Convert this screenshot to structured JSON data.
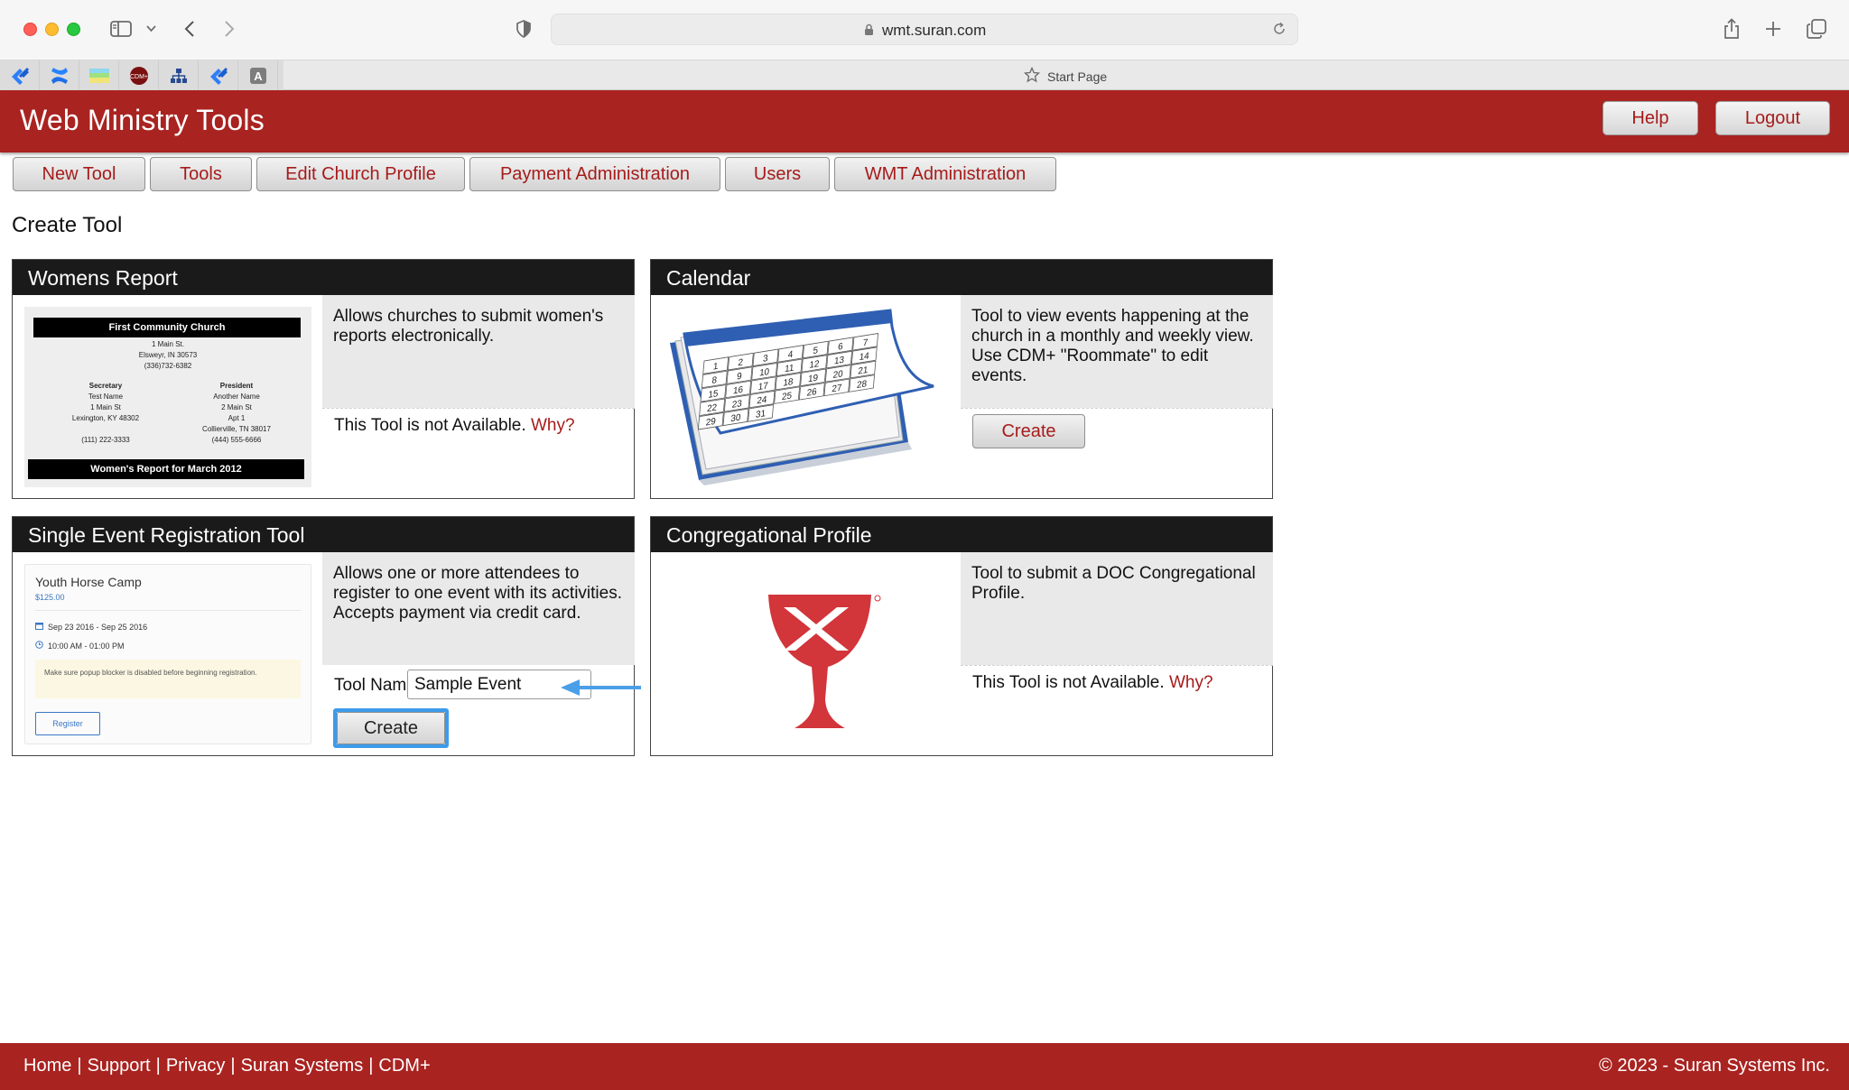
{
  "browser": {
    "url": "wmt.suran.com",
    "start_page_label": "Start Page",
    "favorites_icons": [
      "jira-icon",
      "confluence-icon",
      "spreadsheet-icon",
      "cdm-icon",
      "sitemap-icon",
      "jira-icon",
      "font-app-icon"
    ]
  },
  "app": {
    "title": "Web Ministry Tools",
    "help_label": "Help",
    "logout_label": "Logout",
    "header_color": "#a92320"
  },
  "nav": {
    "items": [
      "New Tool",
      "Tools",
      "Edit Church Profile",
      "Payment Administration",
      "Users",
      "WMT Administration"
    ]
  },
  "page": {
    "title": "Create Tool"
  },
  "cards": {
    "womens": {
      "title": "Womens Report",
      "description": "Allows churches to submit women's reports electronically.",
      "unavailable": "This Tool is not Available.",
      "why": "Why?",
      "thumb": {
        "church": "First Community Church",
        "address": [
          "1 Main St.",
          "Elsweyr, IN 30573",
          "(336)732-6382"
        ],
        "secretary_title": "Secretary",
        "secretary": [
          "Test Name",
          "1 Main St",
          "Lexington, KY 48302"
        ],
        "secretary_phone": "(111) 222-3333",
        "president_title": "President",
        "president": [
          "Another Name",
          "2 Main St",
          "Apt 1",
          "Collierville, TN 38017",
          "(444) 555-6666"
        ],
        "footer": "Women's Report for March 2012"
      }
    },
    "calendar": {
      "title": "Calendar",
      "description": "Tool to view events happening at the church in a monthly and weekly view. Use CDM+ \"Roommate\" to edit events.",
      "create_label": "Create",
      "thumb_days": [
        "1",
        "2",
        "3",
        "4",
        "5",
        "6",
        "7",
        "8",
        "9",
        "10",
        "11",
        "12",
        "13",
        "14",
        "15",
        "16",
        "17",
        "18",
        "19",
        "20",
        "21",
        "22",
        "23",
        "24",
        "25",
        "26",
        "27",
        "28",
        "29",
        "30",
        "31"
      ]
    },
    "event": {
      "title": "Single Event Registration Tool",
      "description": "Allows one or more attendees to register to one event with its activities. Accepts payment via credit card.",
      "tool_name_label": "Tool Name:",
      "tool_name_value": "Sample Event",
      "create_label": "Create",
      "thumb": {
        "event_title": "Youth Horse Camp",
        "price": "$125.00",
        "dates": "Sep 23 2016 - Sep 25 2016",
        "times": "10:00 AM - 01:00 PM",
        "note": "Make sure popup blocker is disabled before beginning registration.",
        "register": "Register"
      }
    },
    "profile": {
      "title": "Congregational Profile",
      "description": "Tool to submit a DOC Congregational Profile.",
      "unavailable": "This Tool is not Available.",
      "why": "Why?"
    }
  },
  "footer": {
    "links": [
      "Home",
      "Support",
      "Privacy",
      "Suran Systems",
      "CDM+"
    ],
    "separator": "|",
    "copyright": "© 2023 - Suran Systems Inc."
  }
}
